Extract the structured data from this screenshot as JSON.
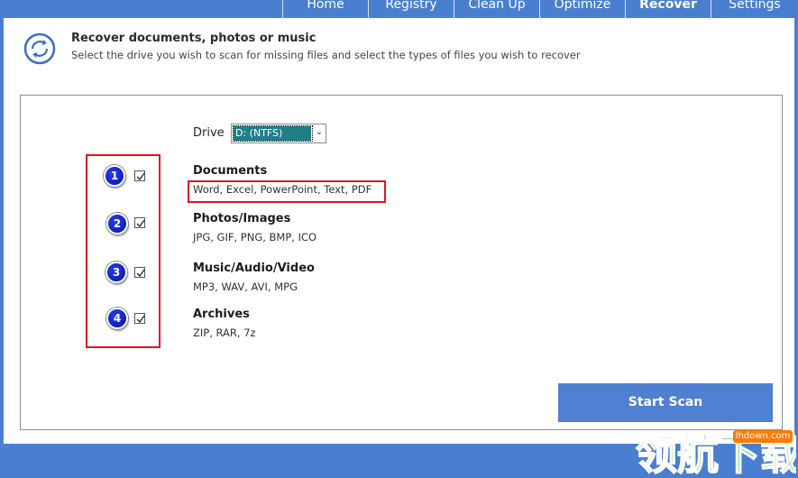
{
  "tabs": [
    {
      "label": "Home",
      "active": false
    },
    {
      "label": "Registry",
      "active": false
    },
    {
      "label": "Clean Up",
      "active": false
    },
    {
      "label": "Optimize",
      "active": false
    },
    {
      "label": "Recover",
      "active": true
    },
    {
      "label": "Settings",
      "active": false
    }
  ],
  "header": {
    "icon": "recover-circle-arrows-icon",
    "title": "Recover documents, photos or music",
    "subtitle": "Select the drive you wish to scan for missing files and select the types of files you wish to recover"
  },
  "drive": {
    "label": "Drive",
    "selected": "D: (NTFS)"
  },
  "categories": [
    {
      "badge": "1",
      "checked": true,
      "title": "Documents",
      "desc": "Word, Excel, PowerPoint, Text, PDF"
    },
    {
      "badge": "2",
      "checked": true,
      "title": "Photos/Images",
      "desc": "JPG, GIF, PNG, BMP, ICO"
    },
    {
      "badge": "3",
      "checked": true,
      "title": "Music/Audio/Video",
      "desc": "MP3, WAV, AVI, MPG"
    },
    {
      "badge": "4",
      "checked": true,
      "title": "Archives",
      "desc": "ZIP, RAR, 7z"
    }
  ],
  "actions": {
    "start_scan": "Start Scan"
  },
  "watermark": {
    "url": "lhdown.com",
    "logo_text": "领航下载"
  },
  "colors": {
    "accent": "#4a7fd0",
    "button": "#4f80d1",
    "highlight_box": "#e0141e",
    "badge": "#0f1fb8",
    "select_highlight": "#1e7f86"
  }
}
